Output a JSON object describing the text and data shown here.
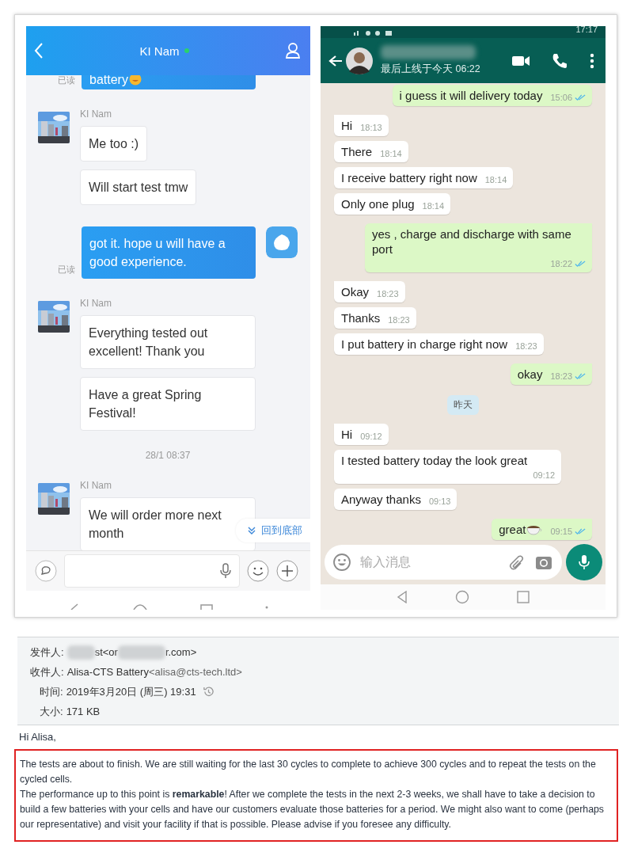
{
  "left_chat": {
    "title": "KI Nam",
    "online": true,
    "messages": [
      {
        "kind": "out",
        "text": "battery",
        "has_emoji": true,
        "read_label": "已读",
        "cut": true
      },
      {
        "kind": "in",
        "sender": "KI Nam",
        "bubbles": [
          "Me too  :)",
          "Will start test tmw"
        ]
      },
      {
        "kind": "out",
        "text": "got it. hope u will have a good experience.",
        "read_label": "已读",
        "cut": false
      },
      {
        "kind": "in",
        "sender": "KI Nam",
        "bubbles": [
          "Everything tested out excellent! Thank you",
          "Have a great Spring Festival!"
        ]
      },
      {
        "kind": "time",
        "text": "28/1 08:37"
      },
      {
        "kind": "in",
        "sender": "KI Nam",
        "bubbles": [
          "We will order more next month"
        ]
      }
    ],
    "jump_button": "回到底部"
  },
  "right_chat": {
    "status_time": "17:17",
    "last_seen": "最后上线于今天 06:22",
    "messages": [
      {
        "kind": "out",
        "text": "i guess it will delivery today",
        "time": "15:06",
        "read": true,
        "tail": false
      },
      {
        "kind": "in",
        "text": "Hi",
        "time": "18:13",
        "tail": true
      },
      {
        "kind": "in",
        "text": "There",
        "time": "18:14",
        "tail": false
      },
      {
        "kind": "in",
        "text": "I receive battery right now",
        "time": "18:14",
        "tail": false
      },
      {
        "kind": "in",
        "text": "Only one plug",
        "time": "18:14",
        "tail": false
      },
      {
        "kind": "out",
        "text": "yes , charge and discharge with same port",
        "time": "18:22",
        "read": true,
        "tail": true
      },
      {
        "kind": "in",
        "text": "Okay",
        "time": "18:23",
        "tail": true
      },
      {
        "kind": "in",
        "text": "Thanks",
        "time": "18:23",
        "tail": false
      },
      {
        "kind": "in",
        "text": "I put battery in charge right now",
        "time": "18:23",
        "tail": false
      },
      {
        "kind": "out",
        "text": "okay",
        "time": "18:23",
        "read": true,
        "tail": true
      },
      {
        "kind": "date",
        "text": "昨天"
      },
      {
        "kind": "in",
        "text": "Hi",
        "time": "09:12",
        "tail": true
      },
      {
        "kind": "in",
        "text": "I tested battery today the look great",
        "time": "09:12",
        "tail": false
      },
      {
        "kind": "in",
        "text": "Anyway thanks",
        "time": "09:13",
        "tail": false
      },
      {
        "kind": "out",
        "text": "great",
        "has_emoji": true,
        "time": "09:15",
        "read": true,
        "tail": true
      }
    ],
    "placeholder": "输入消息"
  },
  "email": {
    "from_label": "发件人:",
    "from_fragments": [
      "st<or",
      "r.com>"
    ],
    "to_label": "收件人:",
    "to_name": "Alisa-CTS Battery",
    "to_address": "<alisa@cts-tech.ltd>",
    "time_label": "时间:",
    "time_value": "2019年3月20日 (周三) 19:31",
    "size_label": "大小:",
    "size_value": "171 KB",
    "greeting": "Hi Alisa,",
    "highlighted": true,
    "paragraphs": [
      "The tests are about to finish. We are still waiting for the last 30 cycles to complete to achieve 300 cycles and to repeat the tests on the cycled cells.",
      "The performance up to this point is **remarkable**! After we complete the tests in the next 2-3 weeks, we shall have to take a decision to build a few batteries with your cells and have our customers evaluate those batteries for a period. We might also want to come (perhaps our representative) and visit your facility if that is possible. Please advise if you foresee  any difficulty."
    ]
  }
}
